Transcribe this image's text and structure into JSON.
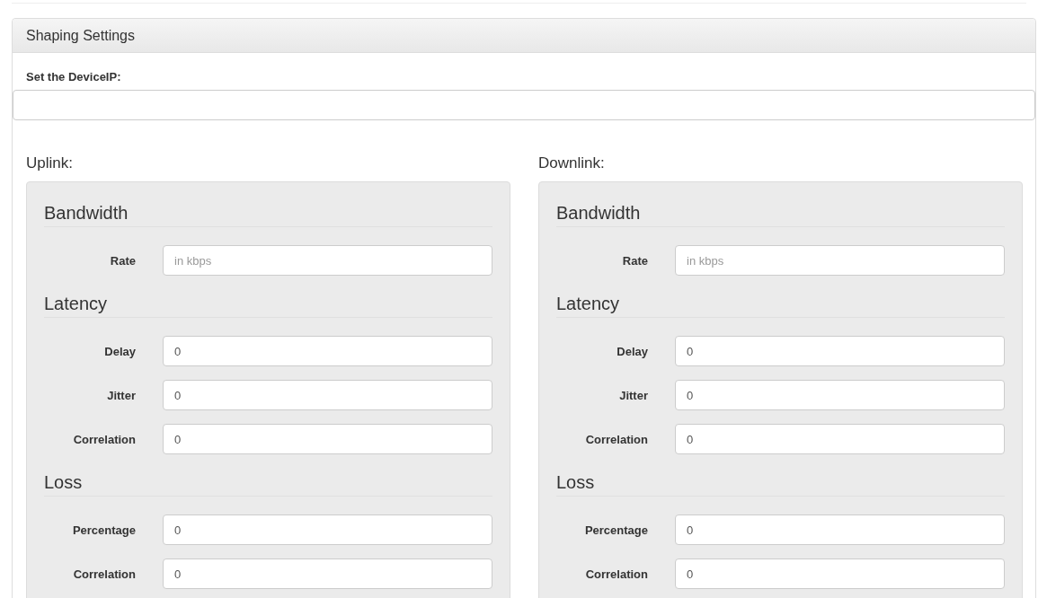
{
  "panel": {
    "title": "Shaping Settings",
    "device_ip": {
      "label": "Set the DeviceIP:"
    }
  },
  "columns": [
    {
      "title": "Uplink:",
      "sections": [
        {
          "heading": "Bandwidth",
          "fields": [
            {
              "label": "Rate",
              "placeholder": "in kbps"
            }
          ]
        },
        {
          "heading": "Latency",
          "fields": [
            {
              "label": "Delay",
              "value": "0"
            },
            {
              "label": "Jitter",
              "value": "0"
            },
            {
              "label": "Correlation",
              "value": "0"
            }
          ]
        },
        {
          "heading": "Loss",
          "fields": [
            {
              "label": "Percentage",
              "value": "0"
            },
            {
              "label": "Correlation",
              "value": "0"
            }
          ]
        }
      ]
    },
    {
      "title": "Downlink:",
      "sections": [
        {
          "heading": "Bandwidth",
          "fields": [
            {
              "label": "Rate",
              "placeholder": "in kbps"
            }
          ]
        },
        {
          "heading": "Latency",
          "fields": [
            {
              "label": "Delay",
              "value": "0"
            },
            {
              "label": "Jitter",
              "value": "0"
            },
            {
              "label": "Correlation",
              "value": "0"
            }
          ]
        },
        {
          "heading": "Loss",
          "fields": [
            {
              "label": "Percentage",
              "value": "0"
            },
            {
              "label": "Correlation",
              "value": "0"
            }
          ]
        }
      ]
    }
  ]
}
